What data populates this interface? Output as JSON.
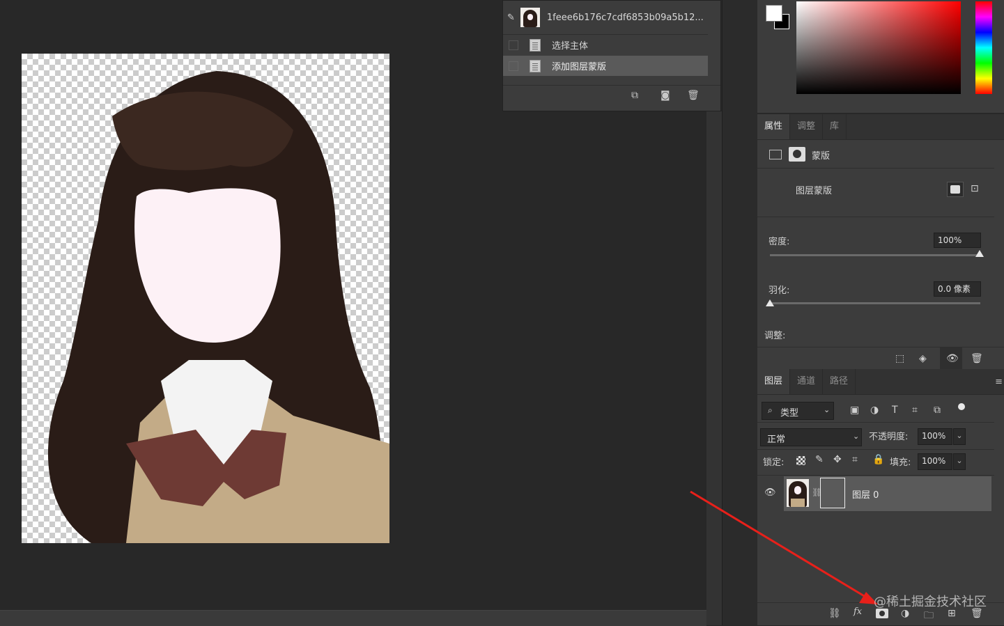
{
  "history": {
    "snapshot_name": "1feee6b176c7cdf6853b09a5b12...",
    "items": [
      {
        "label": "选择主体"
      },
      {
        "label": "添加图层蒙版"
      }
    ]
  },
  "properties": {
    "tabs": [
      "属性",
      "调整",
      "库"
    ],
    "type_label": "蒙版",
    "layer_mask_label": "图层蒙版",
    "density_label": "密度:",
    "density_value": "100%",
    "feather_label": "羽化:",
    "feather_value": "0.0 像素",
    "adjust_label": "调整:"
  },
  "layers": {
    "tabs": [
      "图层",
      "通道",
      "路径"
    ],
    "filter_label": "类型",
    "blend_mode": "正常",
    "opacity_label": "不透明度:",
    "opacity_value": "100%",
    "lock_label": "锁定:",
    "fill_label": "填充:",
    "fill_value": "100%",
    "layer_name": "图层 0",
    "fx_label": "fx"
  },
  "watermark": "@稀土掘金技术社区",
  "colors": {
    "panel_bg": "#3c3c3c",
    "canvas_bg": "#282828",
    "arrow": "#e8201a",
    "accent_red": "#ff0000"
  }
}
